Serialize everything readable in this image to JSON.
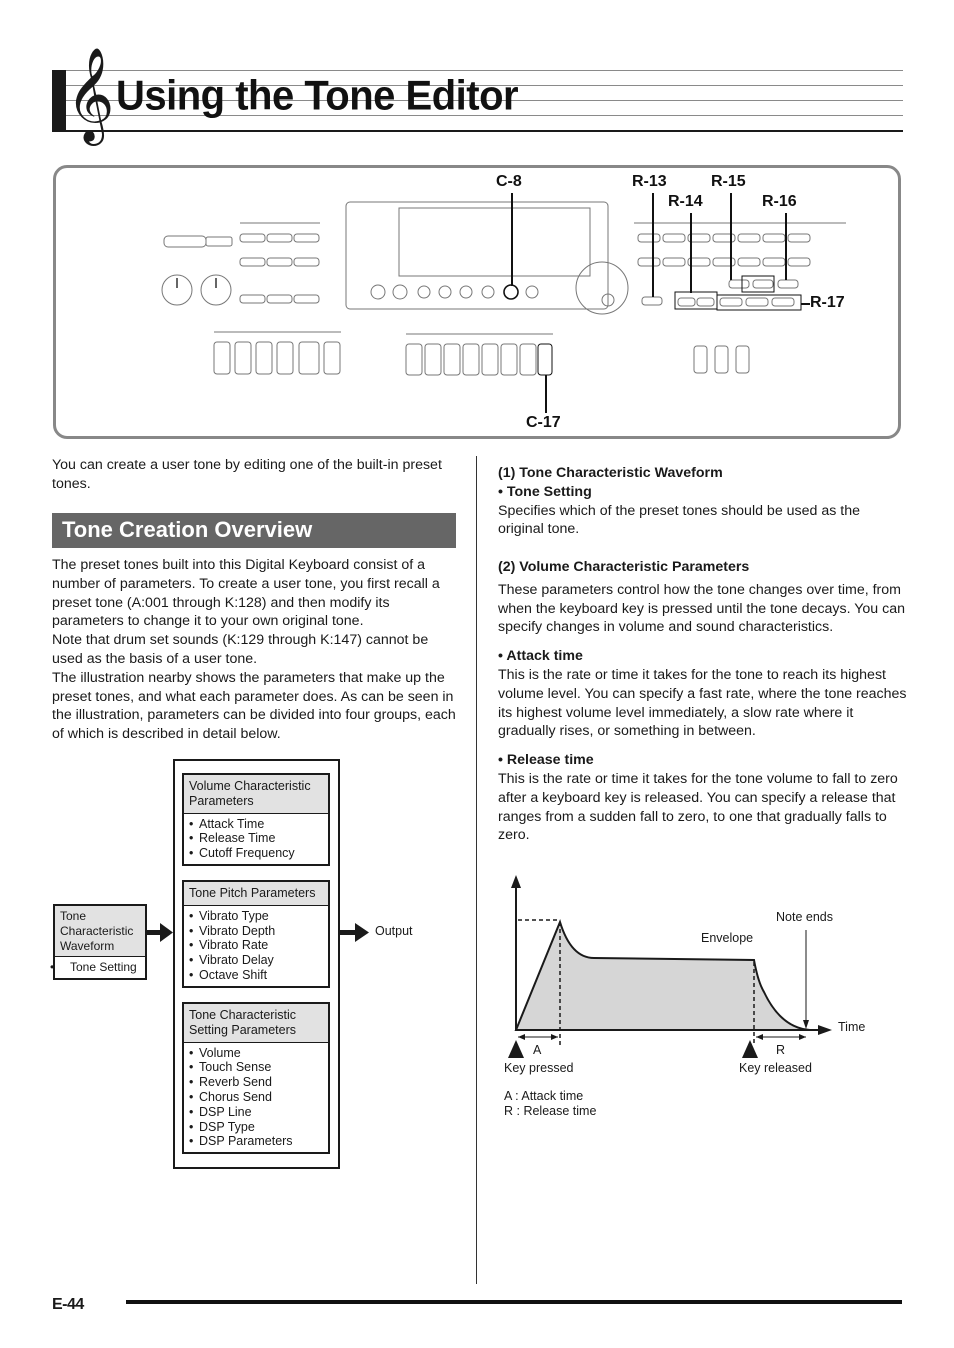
{
  "page": {
    "title": "Using the Tone Editor",
    "clef_symbol": "𝄞",
    "page_number": "E-44"
  },
  "panel": {
    "callouts": {
      "c8": "C-8",
      "c17": "C-17",
      "r13": "R-13",
      "r14": "R-14",
      "r15": "R-15",
      "r16": "R-16",
      "r17": "R-17"
    }
  },
  "left": {
    "intro": "You can create a user tone by editing one of the built-in preset tones.",
    "section_heading": "Tone Creation Overview",
    "paragraphs": [
      "The preset tones built into this Digital Keyboard consist of a number of parameters. To create a user tone, you first recall a preset tone (A:001 through K:128) and then modify its parameters to change it to your own original tone.",
      "Note that drum set sounds (K:129 through K:147) cannot be used as the basis of a user tone.",
      "The illustration nearby shows the parameters that make up the preset tones, and what each parameter does. As can be seen in the illustration, parameters can be divided into four groups, each of which is described in detail below."
    ]
  },
  "diagram": {
    "input_box": {
      "header": "Tone Characteristic Waveform",
      "items": [
        "Tone Setting"
      ]
    },
    "groups": [
      {
        "header": "Volume Characteristic Parameters",
        "items": [
          "Attack Time",
          "Release Time",
          "Cutoff Frequency"
        ]
      },
      {
        "header": "Tone Pitch Parameters",
        "items": [
          "Vibrato Type",
          "Vibrato Depth",
          "Vibrato Rate",
          "Vibrato Delay",
          "Octave Shift"
        ]
      },
      {
        "header": "Tone Characteristic Setting Parameters",
        "items": [
          "Volume",
          "Touch Sense",
          "Reverb Send",
          "Chorus Send",
          "DSP Line",
          "DSP Type",
          "DSP Parameters"
        ]
      }
    ],
    "output_label": "Output"
  },
  "right": {
    "s1_heading": "(1)  Tone Characteristic Waveform",
    "s1_sub": "•  Tone Setting",
    "s1_text": "Specifies which of the preset tones should be used as the original tone.",
    "s2_heading": "(2)  Volume Characteristic Parameters",
    "s2_text": "These parameters control how the tone changes over time, from when the keyboard key is pressed until the tone decays. You can specify changes in volume and sound characteristics.",
    "attack_heading": "•  Attack time",
    "attack_text": "This is the rate or time it takes for the tone to reach its highest volume level. You can specify a fast rate, where the tone reaches its highest volume level immediately, a slow rate where it gradually rises, or something in between.",
    "release_heading": "•  Release time",
    "release_text": "This is the rate or time it takes for the tone volume to fall to zero after a keyboard key is released. You can specify a release that ranges from a sudden fall to zero, to one that gradually falls to zero."
  },
  "envelope": {
    "labels": {
      "note_ends": "Note ends",
      "envelope": "Envelope",
      "time": "Time",
      "a": "A",
      "r": "R",
      "key_pressed": "Key pressed",
      "key_released": "Key released",
      "legend_a": "A : Attack time",
      "legend_r": "R : Release time"
    },
    "fill_color": "#d6d6d6"
  }
}
